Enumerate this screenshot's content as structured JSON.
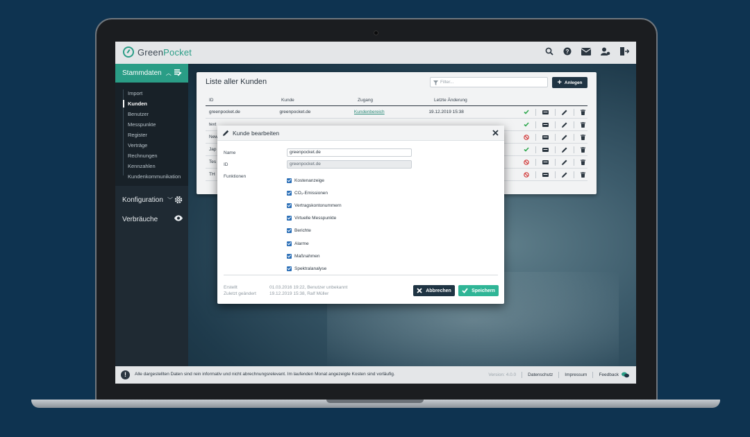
{
  "app": {
    "logo_green": "Green",
    "logo_pocket": "Pocket"
  },
  "sidebar": {
    "active_section": "Stammdaten",
    "items": [
      "Import",
      "Kunden",
      "Benutzer",
      "Messpunkte",
      "Register",
      "Verträge",
      "Rechnungen",
      "Kennzahlen",
      "Kundenkommunikation"
    ],
    "sections": [
      "Konfiguration",
      "Verbräuche"
    ]
  },
  "list": {
    "title": "Liste aller Kunden",
    "filter_placeholder": "Filter...",
    "add_label": "Anlegen",
    "columns": [
      "ID",
      "Kunde",
      "Zugang",
      "Letzte Änderung"
    ],
    "rows": [
      {
        "id": "greenpocket.de",
        "kunde": "greenpocket.de",
        "zugang": "Kundenbereich",
        "changed": "19.12.2019 15:38",
        "status": "ok"
      },
      {
        "id": "text",
        "kunde": "",
        "zugang": "",
        "changed": "",
        "status": "ok"
      },
      {
        "id": "New",
        "kunde": "",
        "zugang": "",
        "changed": "",
        "status": "blocked"
      },
      {
        "id": "Jap",
        "kunde": "",
        "zugang": "",
        "changed": "",
        "status": "ok"
      },
      {
        "id": "Tes",
        "kunde": "",
        "zugang": "",
        "changed": "",
        "status": "blocked"
      },
      {
        "id": "TH",
        "kunde": "",
        "zugang": "",
        "changed": "",
        "status": "blocked"
      }
    ]
  },
  "modal": {
    "title": "Kunde bearbeiten",
    "name_label": "Name",
    "name_value": "greenpocket.de",
    "id_label": "ID",
    "id_value": "greenpocket.de",
    "functions_label": "Funktionen",
    "functions": [
      "Kostenanzeige",
      "CO₂-Emissionen",
      "Vertragskontonummern",
      "Virtuelle Messpunkte",
      "Berichte",
      "Alarme",
      "Maßnahmen",
      "Spektralanalyse"
    ],
    "created_label": "Erstellt",
    "changed_label": "Zuletzt geändert",
    "created_value": "01.03.2016 19:22, Benutzer unbekannt",
    "changed_value": "19.12.2019 15:38, Ralf Müller",
    "cancel_label": "Abbrechen",
    "save_label": "Speichern"
  },
  "footer": {
    "notice": "Alle dargestellten Daten sind rein informativ und nicht abrechnungsrelevant. Im laufenden Monat angezeigte Kosten sind vorläufig.",
    "version": "Version: 4.0.0",
    "privacy": "Datenschutz",
    "imprint": "Impressum",
    "feedback": "Feedback"
  },
  "colors": {
    "accent": "#2a9d86",
    "navy": "#1f3443",
    "save": "#2fb596",
    "checkbox": "#2b6fb7"
  }
}
